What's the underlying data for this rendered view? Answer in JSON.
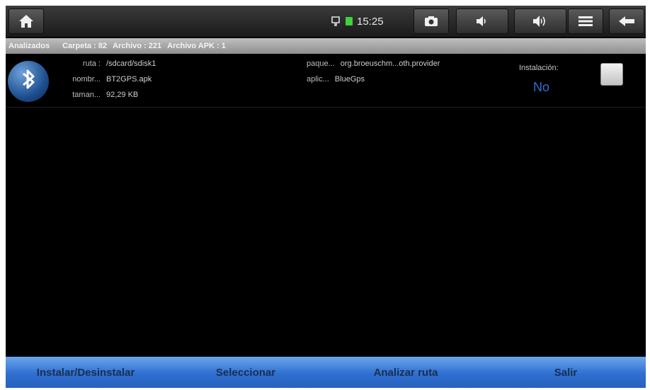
{
  "status_bar": {
    "time": "15:25",
    "icons": [
      "home-icon",
      "usb-icon",
      "battery-icon",
      "camera-icon",
      "volume-down-icon",
      "volume-up-icon",
      "menu-icon",
      "back-icon"
    ],
    "battery_color": "#3fd13f"
  },
  "info_strip": {
    "analyzed": "Analizados",
    "folder": "Carpeta : 82",
    "files": "Archivo : 221",
    "apk_files": "Archivo APK : 1"
  },
  "file": {
    "path_label": "ruta :",
    "path_value": "/sdcard/sdisk1",
    "name_label": "nombr...",
    "name_value": "BT2GPS.apk",
    "size_label": "taman...",
    "size_value": "92,29 KB",
    "package_label": "paque...",
    "package_value": "org.broeuschm...oth.provider",
    "app_label": "aplic...",
    "app_value": "BlueGps",
    "install_label": "Instalación:",
    "install_value": "No"
  },
  "bottom_bar": {
    "install": "Instalar/Desinstalar",
    "select": "Seleccionar",
    "analyze": "Analizar ruta",
    "exit": "Salir"
  },
  "colors": {
    "accent_blue": "#2f6fd0",
    "install_value_blue": "#2f6fd6"
  }
}
